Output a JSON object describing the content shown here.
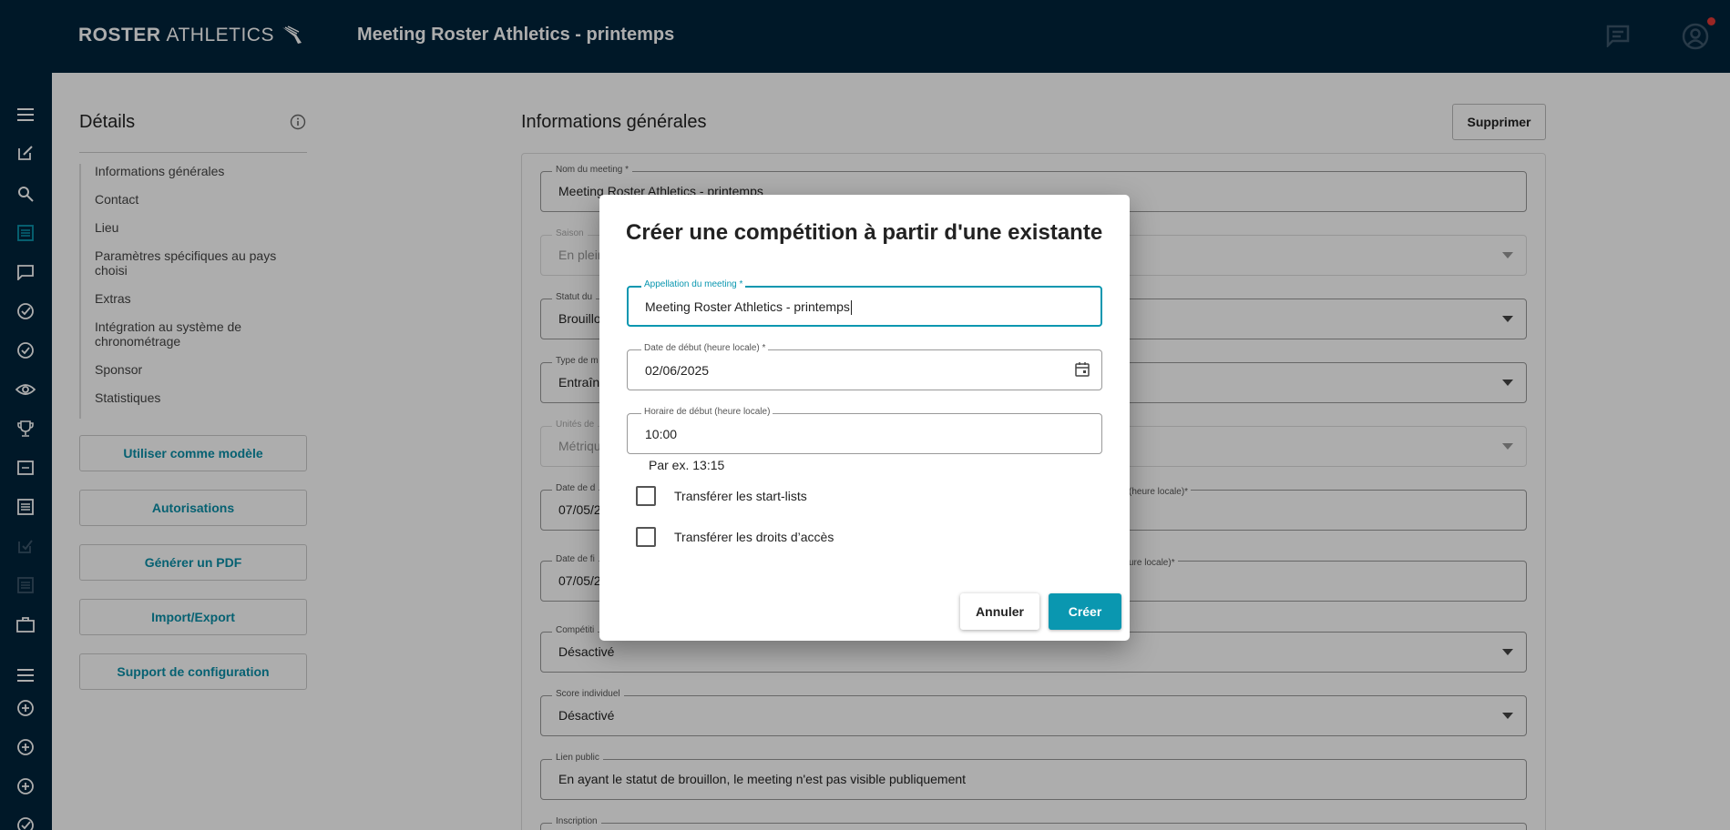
{
  "header": {
    "logo_bold": "ROSTER",
    "logo_thin": "ATHLETICS",
    "title": "Meeting Roster Athletics - printemps"
  },
  "colors": {
    "navy": "#01243b",
    "accent": "#0a97b0",
    "notification": "#e53935"
  },
  "rail_icons": [
    "menu-icon",
    "edit-icon",
    "search-icon",
    "list-icon",
    "chat-icon",
    "check-circle-icon",
    "check-circle-outline-icon",
    "eye-icon",
    "trophy-icon",
    "scoreboard-icon",
    "list-alt-icon",
    "edit-check-icon",
    "list-disabled-icon",
    "briefcase-icon",
    "menu-icon",
    "add-circle-icon",
    "add-circle-icon",
    "add-circle-icon",
    "check-circle-icon"
  ],
  "details": {
    "title": "Détails",
    "toc": [
      "Informations générales",
      "Contact",
      "Lieu",
      "Paramètres spécifiques au pays choisi",
      "Extras",
      "Intégration au système de chronométrage",
      "Sponsor",
      "Statistiques"
    ],
    "buttons": [
      "Utiliser comme modèle",
      "Autorisations",
      "Générer un PDF",
      "Import/Export",
      "Support de configuration"
    ]
  },
  "general": {
    "title": "Informations générales",
    "delete_label": "Supprimer",
    "fields": {
      "nom": {
        "label": "Nom du meeting *",
        "value": "Meeting Roster Athletics - printemps"
      },
      "saison": {
        "label": "Saison",
        "value": "En plein"
      },
      "statut": {
        "label": "Statut du",
        "value": "Brouillo"
      },
      "type": {
        "label": "Type de m",
        "value": "Entraîne"
      },
      "unites": {
        "label": "Unités de",
        "value": "Métrique"
      },
      "date_debut": {
        "label": "Date de d",
        "value": "07/05/2",
        "right_label": "(heure locale)*"
      },
      "date_fin": {
        "label": "Date de fi",
        "value": "07/05/2",
        "right_label": "ure locale)*"
      },
      "competition": {
        "label": "Compétiti",
        "value": "Désactivé"
      },
      "score": {
        "label": "Score individuel",
        "value": "Désactivé"
      },
      "lien": {
        "label": "Lien public",
        "value": "En ayant le statut de brouillon, le meeting n'est pas visible publiquement"
      },
      "inscription": {
        "label": "Inscription"
      }
    }
  },
  "dialog": {
    "title": "Créer une compétition à partir d'une existante",
    "appellation": {
      "label": "Appellation du meeting *",
      "value": "Meeting Roster Athletics - printemps"
    },
    "date": {
      "label": "Date de début (heure locale) *",
      "value": "02/06/2025"
    },
    "horaire": {
      "label": "Horaire de début (heure locale)",
      "value": "10:00"
    },
    "hint": "Par ex. 13:15",
    "chk_startlists": "Transférer les start-lists",
    "chk_droits": "Transférer les droits d’accès",
    "cancel": "Annuler",
    "create": "Créer"
  }
}
